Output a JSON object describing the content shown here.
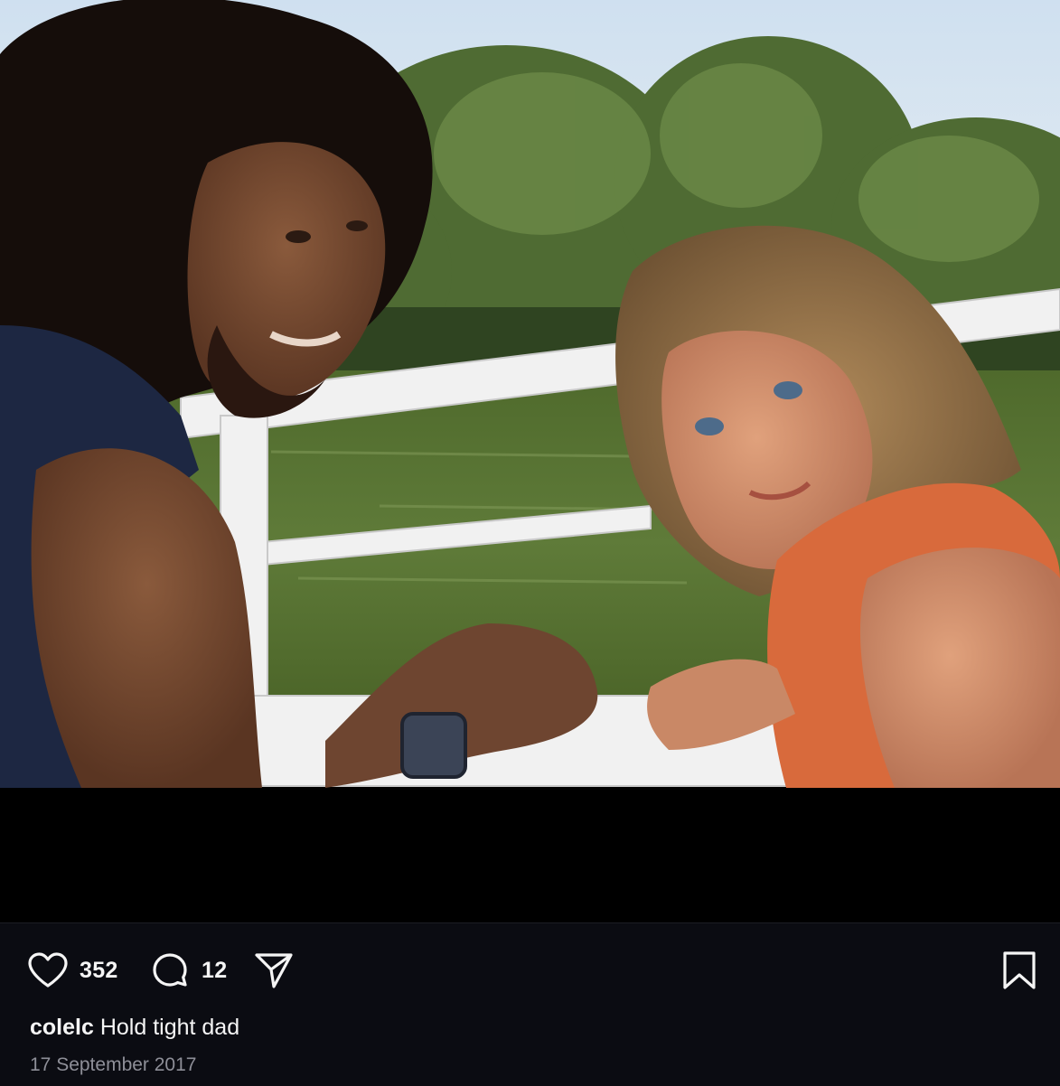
{
  "post": {
    "image_alt": "Man with curly hair and child with blond curls on a boat by green water",
    "likes": "352",
    "comments": "12",
    "icons": {
      "like": "heart-icon",
      "comment": "speech-bubble-icon",
      "share": "paper-plane-icon",
      "save": "bookmark-icon"
    },
    "caption": {
      "username": "colelc",
      "text": "Hold tight dad"
    },
    "date": "17 September 2017"
  },
  "colors": {
    "background": "#0b0c12",
    "text": "#f5f5f5",
    "muted": "#8e8f98",
    "letterbox": "#000000"
  }
}
